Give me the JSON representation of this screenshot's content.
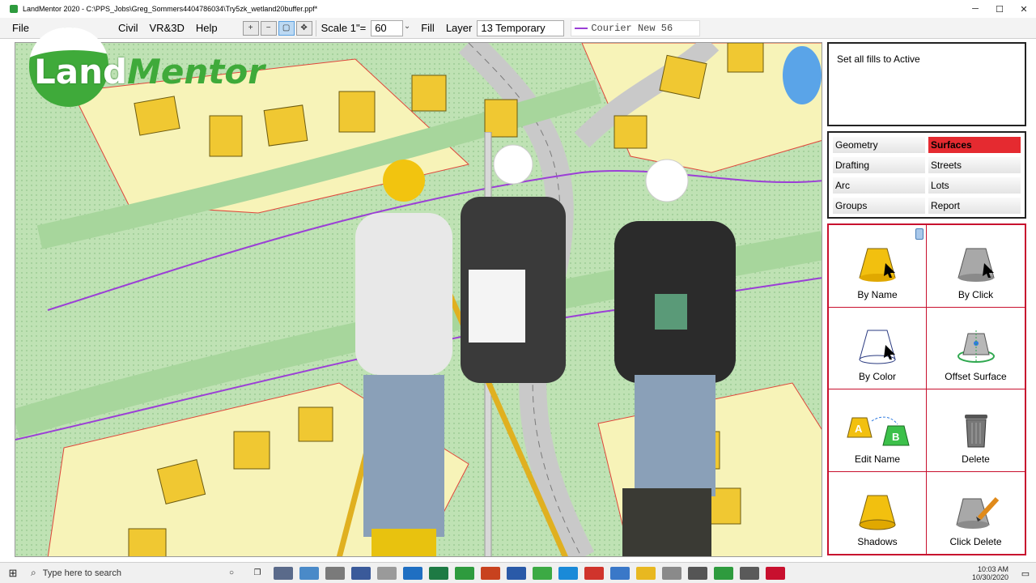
{
  "window": {
    "title": "LandMentor 2020 - C:\\PPS_Jobs\\Greg_Sommers4404786034\\Try5zk_wetland20buffer.ppf*",
    "controls": {
      "minimize": "─",
      "maximize": "☐",
      "close": "✕"
    }
  },
  "menu": {
    "file": "File",
    "civil": "Civil",
    "vr3d": "VR&3D",
    "help": "Help"
  },
  "toolbar": {
    "zoom_icons": [
      "zoom-in-icon",
      "zoom-out-icon",
      "zoom-window-icon",
      "zoom-pan-icon"
    ],
    "scale_label": "Scale 1\"=",
    "scale_value": "60",
    "fill_label": "Fill",
    "layer_label": "Layer",
    "layer_value": "13 Temporary",
    "linestyle": "Courier New 56",
    "linestyle_color": "#9b3fd6"
  },
  "logo": {
    "land": "Land",
    "mentor": "Mentor"
  },
  "info_text": "Set all fills to Active",
  "categories": [
    {
      "label": "Geometry",
      "selected": false
    },
    {
      "label": "Surfaces",
      "selected": true
    },
    {
      "label": "Drafting",
      "selected": false
    },
    {
      "label": "Streets",
      "selected": false
    },
    {
      "label": "Arc",
      "selected": false
    },
    {
      "label": "Lots",
      "selected": false
    },
    {
      "label": "Groups",
      "selected": false
    },
    {
      "label": "Report",
      "selected": false
    }
  ],
  "tools": [
    {
      "label": "By Name",
      "icon": "yellow-cone-cursor-icon"
    },
    {
      "label": "By Click",
      "icon": "gray-cone-cursor-icon"
    },
    {
      "label": "By Color",
      "icon": "white-cone-cursor-icon"
    },
    {
      "label": "Offset Surface",
      "icon": "offset-surface-icon"
    },
    {
      "label": "Edit Name",
      "icon": "rename-a-b-icon",
      "a": "A",
      "b": "B"
    },
    {
      "label": "Delete",
      "icon": "trash-can-icon"
    },
    {
      "label": "Shadows",
      "icon": "yellow-cone-icon"
    },
    {
      "label": "Click Delete",
      "icon": "pencil-cone-icon"
    }
  ],
  "taskbar": {
    "search_placeholder": "Type here to search",
    "time": "10:03 AM",
    "date": "10/30/2020"
  },
  "colors": {
    "accent_red": "#c8102e",
    "selected_category": "#e52a30",
    "map_green": "#bfe2b4",
    "lot_yellow": "#f7f3b8",
    "house_yellow": "#f0c832",
    "road_gray": "#c9c9c9",
    "wetland_purple": "#9b3fd6"
  }
}
